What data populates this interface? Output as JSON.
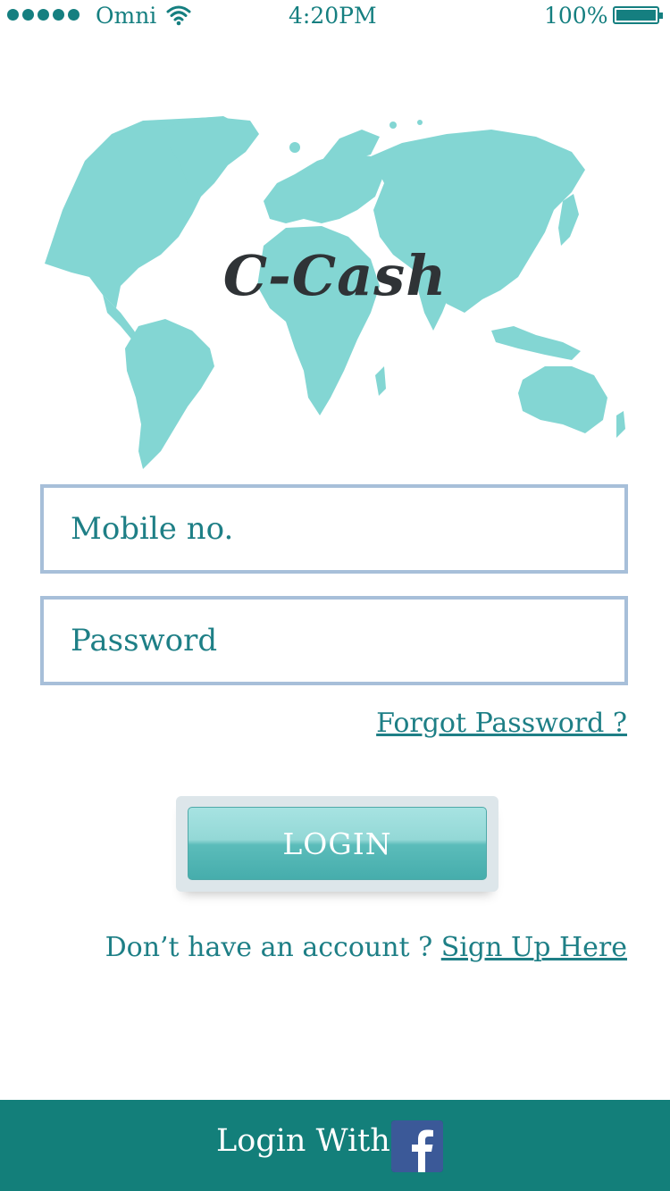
{
  "status_bar": {
    "carrier": "Omni",
    "time": "4:20PM",
    "battery": "100%",
    "signal_icon": "signal-dots-icon",
    "wifi_icon": "wifi-icon",
    "battery_icon": "battery-icon"
  },
  "app": {
    "logo": "C-Cash",
    "map_icon": "world-map-icon",
    "accent_color": "#1e7f86",
    "footer_color": "#137f7a"
  },
  "form": {
    "mobile_placeholder": "Mobile no.",
    "password_placeholder": "Password",
    "forgot_label": "Forgot Password ?",
    "login_label": "LOGIN",
    "signup_prompt": "Don’t have an account ?",
    "signup_link": "Sign Up Here"
  },
  "footer": {
    "label": "Login With",
    "social_icon": "facebook-icon"
  }
}
